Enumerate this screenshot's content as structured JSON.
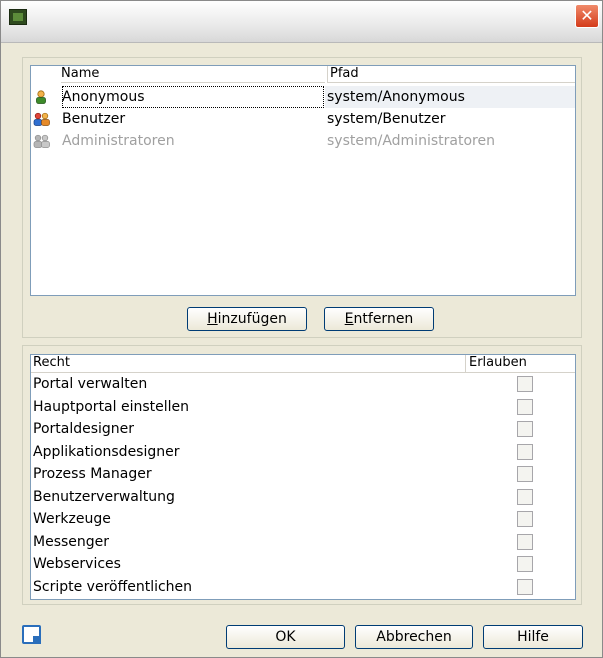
{
  "window": {
    "title": "",
    "close_glyph": "✕"
  },
  "principals": {
    "columns": {
      "name": "Name",
      "path": "Pfad"
    },
    "rows": [
      {
        "name": "Anonymous",
        "path": "system/Anonymous",
        "icon": "user-icon",
        "selected": true,
        "disabled": false
      },
      {
        "name": "Benutzer",
        "path": "system/Benutzer",
        "icon": "users-icon",
        "selected": false,
        "disabled": false
      },
      {
        "name": "Administratoren",
        "path": "system/Administratoren",
        "icon": "admins-icon",
        "selected": false,
        "disabled": true
      }
    ]
  },
  "buttons": {
    "add": {
      "mnemonic": "H",
      "rest": "inzufügen"
    },
    "remove": {
      "mnemonic": "E",
      "rest": "ntfernen"
    },
    "ok": "OK",
    "cancel": "Abbrechen",
    "help": "Hilfe"
  },
  "rights": {
    "columns": {
      "right": "Recht",
      "allow": "Erlauben"
    },
    "rows": [
      {
        "label": "Portal verwalten",
        "allowed": false
      },
      {
        "label": "Hauptportal einstellen",
        "allowed": false
      },
      {
        "label": "Portaldesigner",
        "allowed": false
      },
      {
        "label": "Applikationsdesigner",
        "allowed": false
      },
      {
        "label": "Prozess Manager",
        "allowed": false
      },
      {
        "label": "Benutzerverwaltung",
        "allowed": false
      },
      {
        "label": "Werkzeuge",
        "allowed": false
      },
      {
        "label": "Messenger",
        "allowed": false
      },
      {
        "label": "Webservices",
        "allowed": false
      },
      {
        "label": "Scripte veröffentlichen",
        "allowed": false
      }
    ]
  },
  "colors": {
    "accent": "#2a6ebb",
    "close_red": "#d43b1a",
    "disabled_text": "#a0a0a0"
  }
}
